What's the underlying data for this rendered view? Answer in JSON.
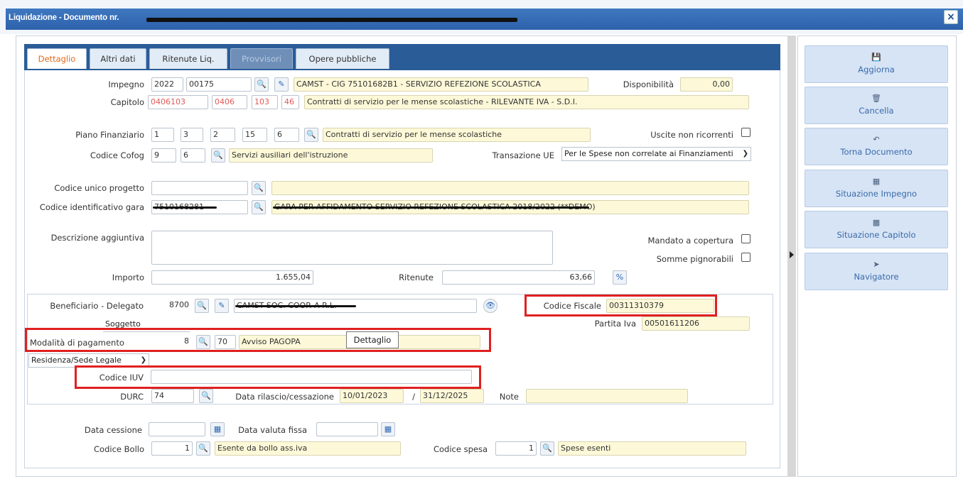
{
  "window": {
    "title": "Liquidazione - Documento nr.",
    "close_label": "×"
  },
  "tabs": [
    {
      "label": "Dettaglio"
    },
    {
      "label": "Altri dati"
    },
    {
      "label": "Ritenute Liq."
    },
    {
      "label": "Provvisori"
    },
    {
      "label": "Opere pubbliche"
    }
  ],
  "impegno": {
    "label": "Impegno",
    "anno": "2022",
    "numero": "00175",
    "descrizione": "CAMST - CIG 75101682B1 - SERVIZIO REFEZIONE SCOLASTICA",
    "disponibilita_label": "Disponibilità",
    "disponibilita": "0,00"
  },
  "capitolo": {
    "label": "Capitolo",
    "codice": "0406103",
    "c2": "0406",
    "c3": "103",
    "c4": "46",
    "descrizione": "Contratti di servizio per le mense scolastiche - RILEVANTE IVA - S.D.I."
  },
  "piano": {
    "label": "Piano Finanziario",
    "v1": "1",
    "v2": "3",
    "v3": "2",
    "v4": "15",
    "v5": "6",
    "descrizione": "Contratti di servizio per le mense scolastiche",
    "uscite_label": "Uscite non ricorrenti"
  },
  "cofog": {
    "label": "Codice Cofog",
    "v1": "9",
    "v2": "6",
    "descrizione": "Servizi ausiliari dell'istruzione",
    "transazione_label": "Transazione UE",
    "transazione_value": "Per le Spese non correlate ai Finanziamenti"
  },
  "cup": {
    "label": "Codice unico progetto",
    "value": ""
  },
  "cig": {
    "label": "Codice identificativo gara",
    "value": "7510168281",
    "descrizione": "GARA PER AFFIDAMENTO SERVIZIO REFEZIONE SCOLASTICA 2018/2022",
    "suffix": "(**DEMO)"
  },
  "descrizione_agg": {
    "label": "Descrizione aggiuntiva",
    "mandato_label": "Mandato a copertura",
    "somme_label": "Somme pignorabili"
  },
  "importo": {
    "label": "Importo",
    "value": "1.655,04",
    "ritenute_label": "Ritenute",
    "ritenute_value": "63,66",
    "perc": "%"
  },
  "beneficiario": {
    "label": "Beneficiario - Delegato",
    "codice": "8700",
    "nome": "CAMST SOC. COOP. A R.L.",
    "soggetto": "Soggetto",
    "cf_label": "Codice Fiscale",
    "cf_value": "00311310379",
    "piva_label": "Partita Iva",
    "piva_value": "00501611206"
  },
  "pagamento": {
    "label": "Modalità di pagamento",
    "codice": "8",
    "tipo": "70",
    "descrizione": "Avviso PAGOPA",
    "tooltip": "Dettaglio",
    "residenza": "Residenza/Sede Legale"
  },
  "iuv": {
    "label": "Codice IUV",
    "value": ""
  },
  "durc": {
    "label": "DURC",
    "value": "74",
    "data_label": "Data rilascio/cessazione",
    "data_from": "10/01/2023",
    "sep": "/",
    "data_to": "31/12/2025",
    "note_label": "Note"
  },
  "cessione": {
    "label": "Data cessione",
    "valuta_label": "Data valuta fissa"
  },
  "bollo": {
    "label": "Codice Bollo",
    "value": "1",
    "descrizione": "Esente da bollo ass.iva",
    "spesa_label": "Codice spesa",
    "spesa_value": "1",
    "spesa_descr": "Spese esenti"
  },
  "actions": [
    {
      "label": "Aggiorna",
      "icon": "save-icon"
    },
    {
      "label": "Cancella",
      "icon": "trash-icon"
    },
    {
      "label": "Torna Documento",
      "icon": "back-arrow-icon"
    },
    {
      "label": "Situazione Impegno",
      "icon": "grid-icon"
    },
    {
      "label": "Situazione Capitolo",
      "icon": "calculator-icon"
    },
    {
      "label": "Navigatore",
      "icon": "navigate-icon"
    }
  ],
  "colors": {
    "titlebar": "#2d62ab",
    "tabbar": "#2a5c98",
    "highlight": "#e02020",
    "active_tab": "#e06b1f"
  }
}
